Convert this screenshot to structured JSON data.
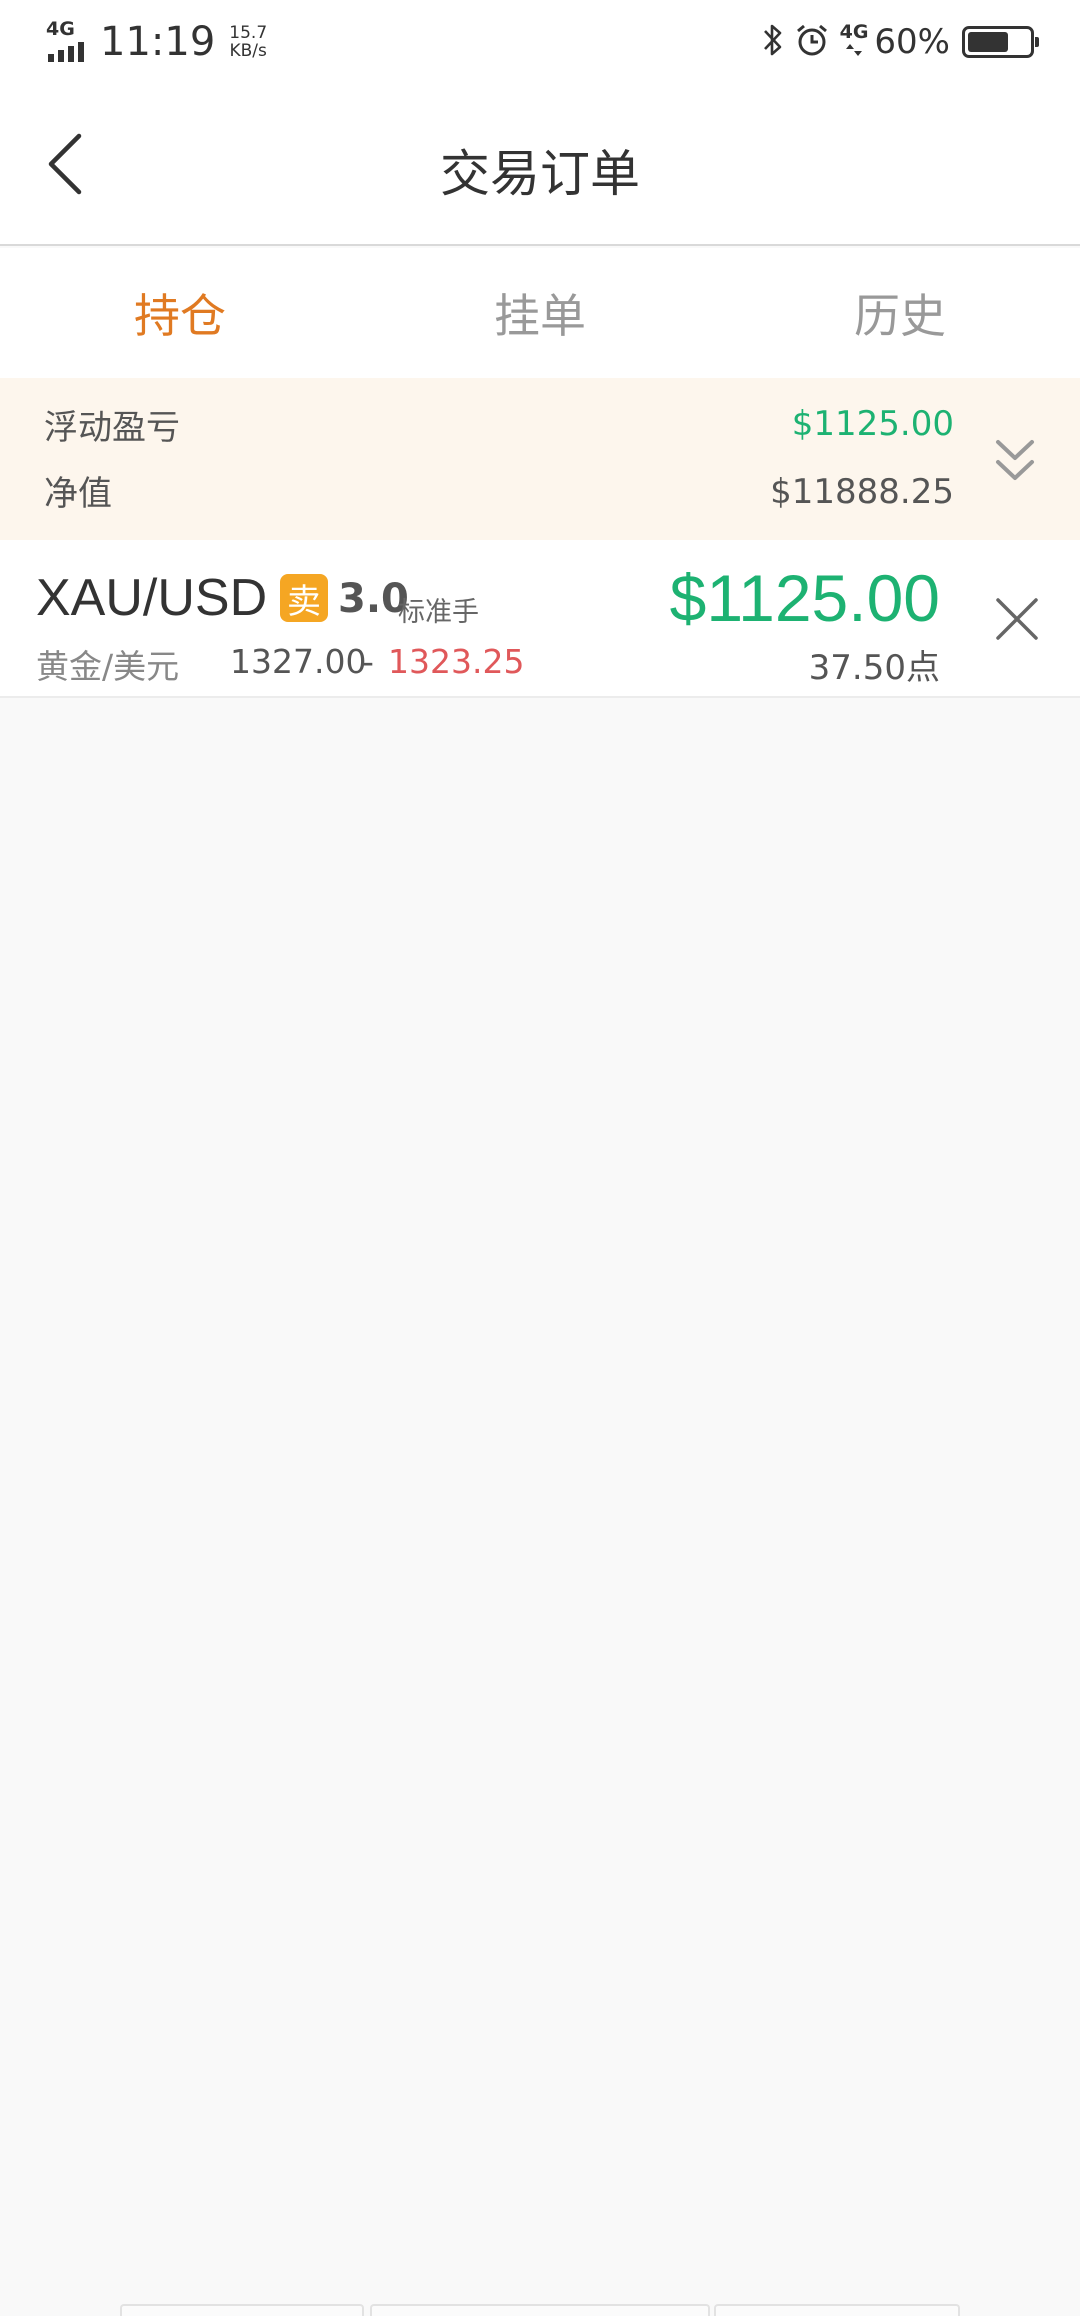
{
  "status_bar": {
    "network_left": "4G",
    "time": "11:19",
    "net_speed_value": "15.7",
    "net_speed_unit": "KB/s",
    "network_right": "4G",
    "battery_percent": "60%",
    "battery_level": 0.6,
    "icons": [
      "signal-icon",
      "bluetooth-icon",
      "alarm-icon",
      "battery-icon"
    ]
  },
  "header": {
    "title": "交易订单",
    "back_icon": "back-chevron-icon"
  },
  "tabs": [
    {
      "label": "持仓",
      "active": true
    },
    {
      "label": "挂单",
      "active": false
    },
    {
      "label": "历史",
      "active": false
    }
  ],
  "summary": {
    "floating_pnl_label": "浮动盈亏",
    "floating_pnl_value": "$1125.00",
    "equity_label": "净值",
    "equity_value": "$11888.25",
    "expand_icon": "double-chevron-down-icon"
  },
  "positions": [
    {
      "symbol": "XAU/USD",
      "side": "卖",
      "lots": "3.0",
      "lot_unit": "标准手",
      "name": "黄金/美元",
      "open_price": "1327.00",
      "separator": "-",
      "current_price": "1323.25",
      "pnl": "$1125.00",
      "points": "37.50点",
      "close_icon": "close-icon"
    }
  ],
  "colors": {
    "accent": "#e07a22",
    "profit": "#1db272",
    "loss": "#e0585a",
    "sell_badge": "#f5a623",
    "summary_bg": "#fdf6ed"
  }
}
